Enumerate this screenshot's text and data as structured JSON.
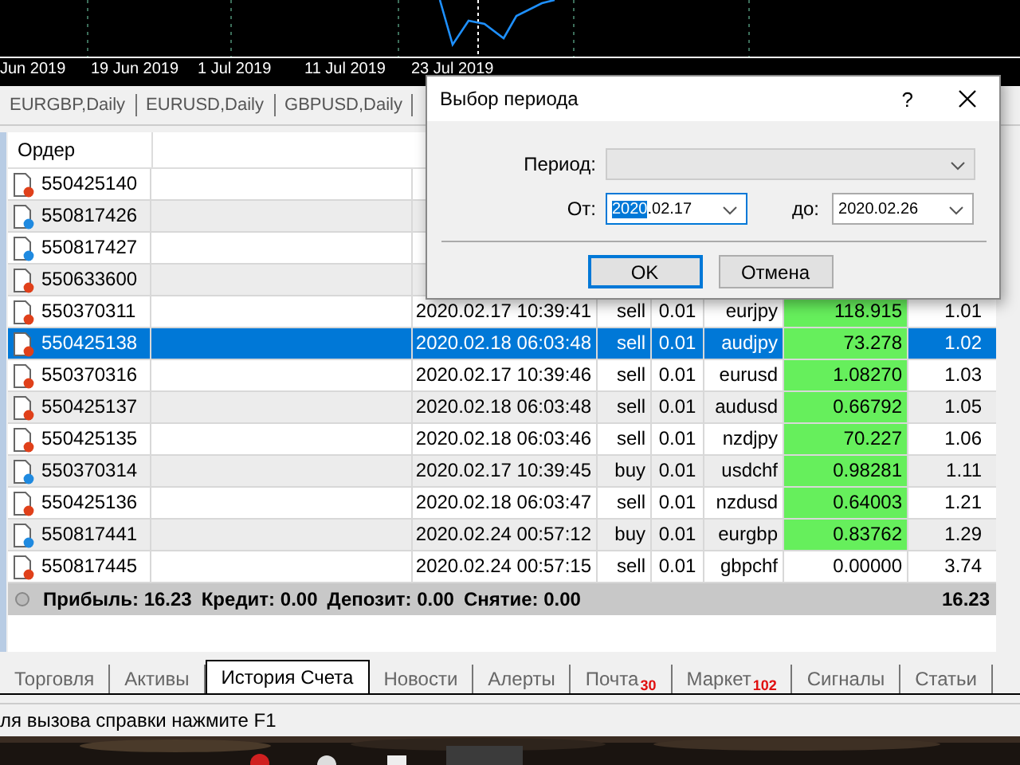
{
  "chart": {
    "dates": [
      "Jun 2019",
      "19 Jun 2019",
      "1 Jul 2019",
      "11 Jul 2019",
      "23 Jul 2019"
    ]
  },
  "chart_tabs": [
    {
      "label": "EURGBP,Daily",
      "selected": false
    },
    {
      "label": "EURUSD,Daily",
      "selected": false
    },
    {
      "label": "GBPUSD,Daily",
      "selected": false
    }
  ],
  "table": {
    "columns": [
      "Ордер"
    ],
    "rows": [
      {
        "order": "550425140",
        "color": "#e0401a",
        "selected": false
      },
      {
        "order": "550817426",
        "color": "#1f8ae0",
        "selected": false
      },
      {
        "order": "550817427",
        "color": "#1f8ae0",
        "selected": false
      },
      {
        "order": "550633600",
        "color": "#e0401a",
        "selected": false
      },
      {
        "order": "550370311",
        "color": "#e0401a",
        "selected": false,
        "time": "2020.02.17 10:39:41",
        "type": "sell",
        "volume": "0.01",
        "symbol": "eurjpy",
        "price": "118.915",
        "highlight": true,
        "value": "1.01"
      },
      {
        "order": "550425138",
        "color": "#e0401a",
        "selected": true,
        "time": "2020.02.18 06:03:48",
        "type": "sell",
        "volume": "0.01",
        "symbol": "audjpy",
        "price": "73.278",
        "highlight": true,
        "value": "1.02"
      },
      {
        "order": "550370316",
        "color": "#e0401a",
        "selected": false,
        "time": "2020.02.17 10:39:46",
        "type": "sell",
        "volume": "0.01",
        "symbol": "eurusd",
        "price": "1.08270",
        "highlight": true,
        "value": "1.03"
      },
      {
        "order": "550425137",
        "color": "#e0401a",
        "selected": false,
        "time": "2020.02.18 06:03:48",
        "type": "sell",
        "volume": "0.01",
        "symbol": "audusd",
        "price": "0.66792",
        "highlight": true,
        "value": "1.05"
      },
      {
        "order": "550425135",
        "color": "#e0401a",
        "selected": false,
        "time": "2020.02.18 06:03:46",
        "type": "sell",
        "volume": "0.01",
        "symbol": "nzdjpy",
        "price": "70.227",
        "highlight": true,
        "value": "1.06"
      },
      {
        "order": "550370314",
        "color": "#1f8ae0",
        "selected": false,
        "time": "2020.02.17 10:39:45",
        "type": "buy",
        "volume": "0.01",
        "symbol": "usdchf",
        "price": "0.98281",
        "highlight": true,
        "value": "1.11"
      },
      {
        "order": "550425136",
        "color": "#e0401a",
        "selected": false,
        "time": "2020.02.18 06:03:47",
        "type": "sell",
        "volume": "0.01",
        "symbol": "nzdusd",
        "price": "0.64003",
        "highlight": true,
        "value": "1.21"
      },
      {
        "order": "550817441",
        "color": "#1f8ae0",
        "selected": false,
        "time": "2020.02.24 00:57:12",
        "type": "buy",
        "volume": "0.01",
        "symbol": "eurgbp",
        "price": "0.83762",
        "highlight": true,
        "value": "1.29"
      },
      {
        "order": "550817445",
        "color": "#e0401a",
        "selected": false,
        "time": "2020.02.24 00:57:15",
        "type": "sell",
        "volume": "0.01",
        "symbol": "gbpchf",
        "price": "0.00000",
        "highlight": false,
        "value": "3.74"
      }
    ],
    "summary": {
      "items": [
        "Прибыль: 16.23",
        "Кредит: 0.00",
        "Депозит: 0.00",
        "Снятие: 0.00"
      ],
      "total": "16.23"
    }
  },
  "bottom_tabs": [
    {
      "label": "Торговля",
      "selected": false
    },
    {
      "label": "Активы",
      "selected": false
    },
    {
      "label": "История Счета",
      "selected": true
    },
    {
      "label": "Новости",
      "selected": false
    },
    {
      "label": "Алерты",
      "selected": false
    },
    {
      "label": "Почта",
      "badge": "30",
      "selected": false
    },
    {
      "label": "Маркет",
      "badge": "102",
      "selected": false
    },
    {
      "label": "Сигналы",
      "selected": false
    },
    {
      "label": "Статьи",
      "selected": false
    }
  ],
  "status_bar": "ля вызова справки нажмите F1",
  "dialog": {
    "title": "Выбор периода",
    "help": "?",
    "period_label": "Период:",
    "period_disabled": true,
    "from_label": "От:",
    "from_selected_text": "2020",
    "from_rest_text": ".02.17",
    "to_label": "до:",
    "to_value": "2020.02.26",
    "ok": "OK",
    "cancel": "Отмена"
  }
}
